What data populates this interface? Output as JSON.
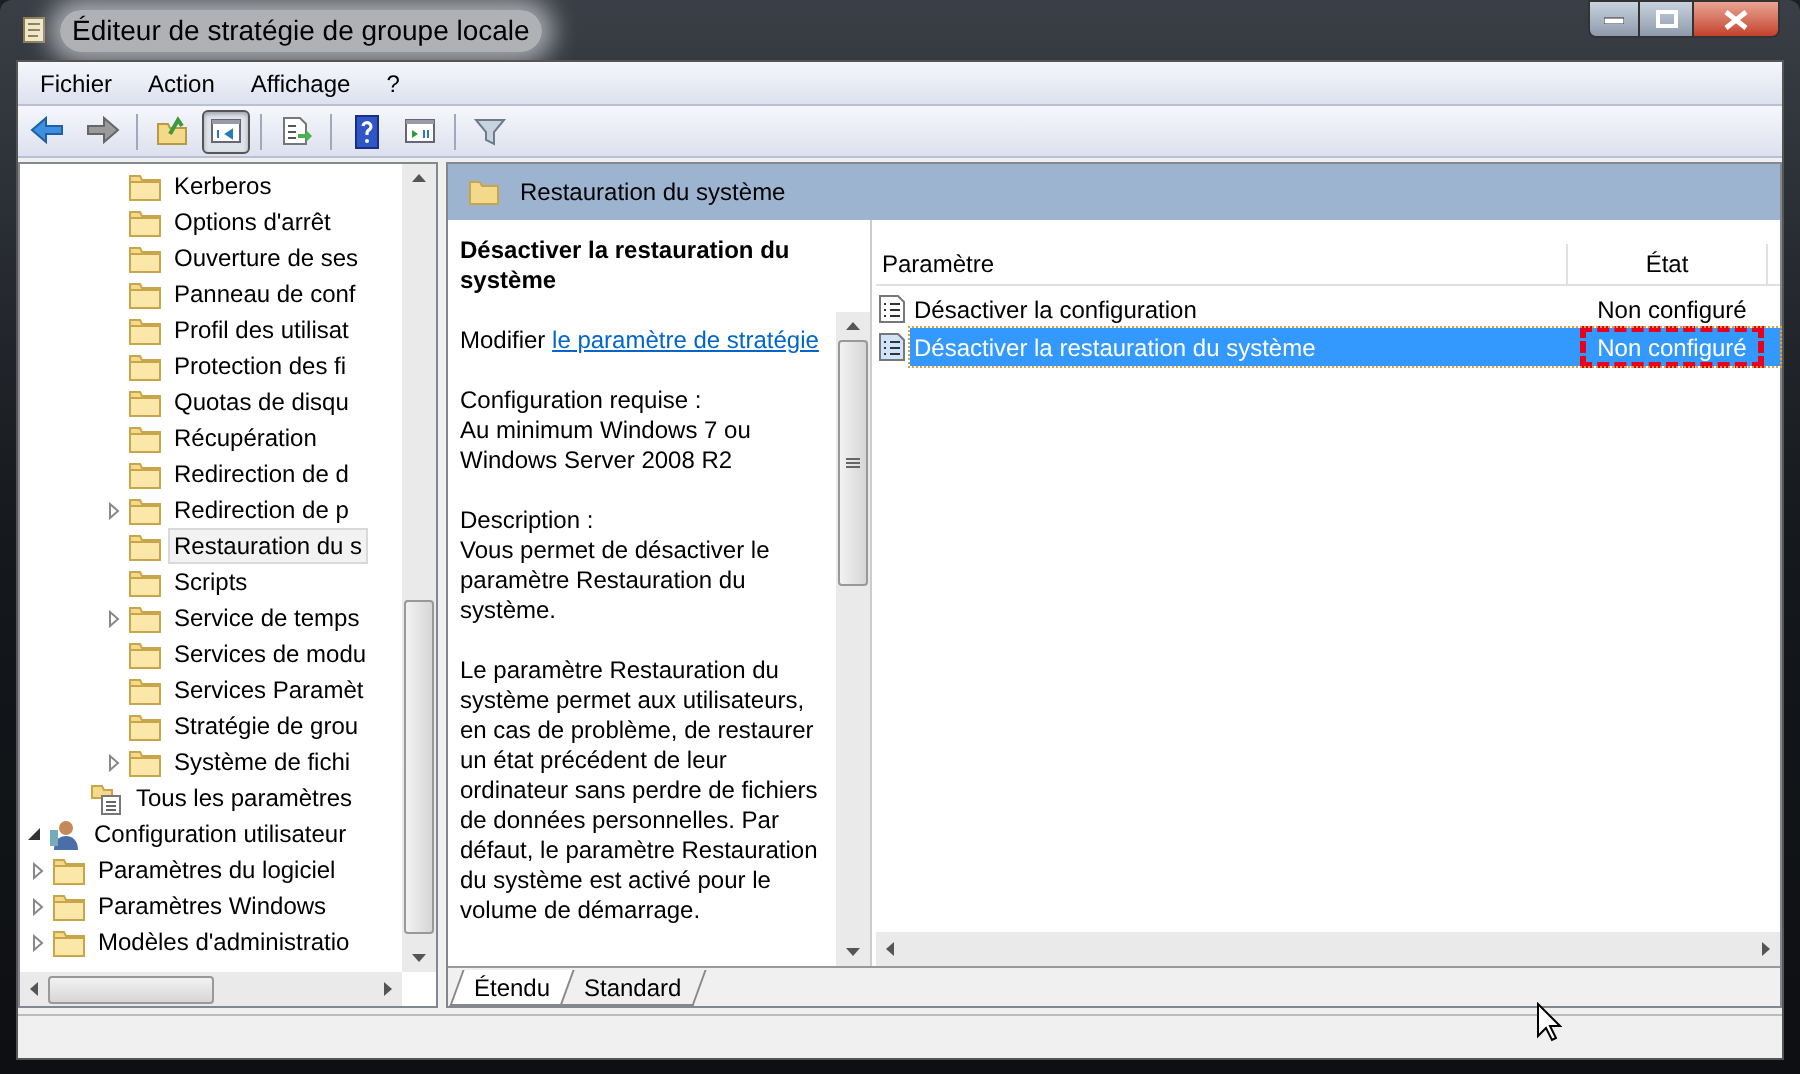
{
  "window": {
    "title": "Éditeur de stratégie de groupe locale"
  },
  "menu": [
    "Fichier",
    "Action",
    "Affichage",
    "?"
  ],
  "toolbar": [
    {
      "kind": "back",
      "pressed": false
    },
    {
      "kind": "forward",
      "pressed": false
    },
    {
      "kind": "sep"
    },
    {
      "kind": "up",
      "pressed": false
    },
    {
      "kind": "tree",
      "pressed": true
    },
    {
      "kind": "sep"
    },
    {
      "kind": "export",
      "pressed": false
    },
    {
      "kind": "sep"
    },
    {
      "kind": "help",
      "pressed": false
    },
    {
      "kind": "panel",
      "pressed": false
    },
    {
      "kind": "sep"
    },
    {
      "kind": "filter",
      "pressed": false
    }
  ],
  "tree": [
    {
      "children": [
        {
          "children": [
            {
              "children": [
                {
                  "label": "Kerberos",
                  "kind": "folder",
                  "selected": false
                },
                {
                  "label": "Options d'arrêt",
                  "kind": "folder",
                  "selected": false
                },
                {
                  "label": "Ouverture de ses",
                  "kind": "folder",
                  "selected": false
                },
                {
                  "label": "Panneau de conf",
                  "kind": "folder",
                  "selected": false
                },
                {
                  "label": "Profil des utilisat",
                  "kind": "folder",
                  "selected": false
                },
                {
                  "label": "Protection des fi",
                  "kind": "folder",
                  "selected": false
                },
                {
                  "label": "Quotas de disqu",
                  "kind": "folder",
                  "selected": false
                },
                {
                  "label": "Récupération",
                  "kind": "folder",
                  "selected": false
                },
                {
                  "label": "Redirection de d",
                  "kind": "folder",
                  "selected": false
                },
                {
                  "label": "Redirection de p",
                  "kind": "folder",
                  "selected": false,
                  "expanded": false
                },
                {
                  "label": "Restauration du s",
                  "kind": "folder",
                  "selected": true
                },
                {
                  "label": "Scripts",
                  "kind": "folder",
                  "selected": false
                },
                {
                  "label": "Service de temps",
                  "kind": "folder",
                  "selected": false,
                  "expanded": false
                },
                {
                  "label": "Services de modu",
                  "kind": "folder",
                  "selected": false
                },
                {
                  "label": "Services Paramèt",
                  "kind": "folder",
                  "selected": false
                },
                {
                  "label": "Stratégie de grou",
                  "kind": "folder",
                  "selected": false
                },
                {
                  "label": "Système de fichi",
                  "kind": "folder",
                  "selected": false,
                  "expanded": false
                }
              ]
            },
            {
              "label": "Tous les paramètres",
              "kind": "settings",
              "selected": false
            }
          ]
        }
      ]
    },
    {
      "label": "Configuration utilisateur",
      "kind": "user",
      "selected": false,
      "expanded": true,
      "children": [
        {
          "label": "Paramètres du logiciel",
          "kind": "folder",
          "selected": false,
          "expanded": false
        },
        {
          "label": "Paramètres Windows",
          "kind": "folder",
          "selected": false,
          "expanded": false
        },
        {
          "label": "Modèles d'administratio",
          "kind": "folder",
          "selected": false,
          "expanded": false
        }
      ]
    }
  ],
  "header": {
    "title": "Restauration du système"
  },
  "description": {
    "title": "Désactiver la restauration du système",
    "edit_prefix": "Modifier",
    "edit_link": "le paramètre de stratégie",
    "sections": [
      {
        "label": "Configuration requise :",
        "text": "Au minimum Windows 7 ou Windows Server 2008 R2"
      },
      {
        "label": "Description :",
        "text": "Vous permet de désactiver le paramètre Restauration du système."
      },
      {
        "text": "Le paramètre Restauration du système permet aux utilisateurs, en cas de problème, de restaurer un état précédent de leur ordinateur sans perdre de fichiers de données personnelles. Par défaut, le paramètre Restauration du système est activé pour le volume de démarrage."
      }
    ]
  },
  "table": {
    "columns": [
      "Paramètre",
      "État"
    ],
    "rows": [
      {
        "name": "Désactiver la configuration",
        "state": "Non configuré",
        "selected": false,
        "annotated": false
      },
      {
        "name": "Désactiver la restauration du système",
        "state": "Non configuré",
        "selected": true,
        "annotated": true
      }
    ]
  },
  "tabs": [
    {
      "label": "Étendu",
      "selected": true
    },
    {
      "label": "Standard",
      "selected": false
    }
  ]
}
